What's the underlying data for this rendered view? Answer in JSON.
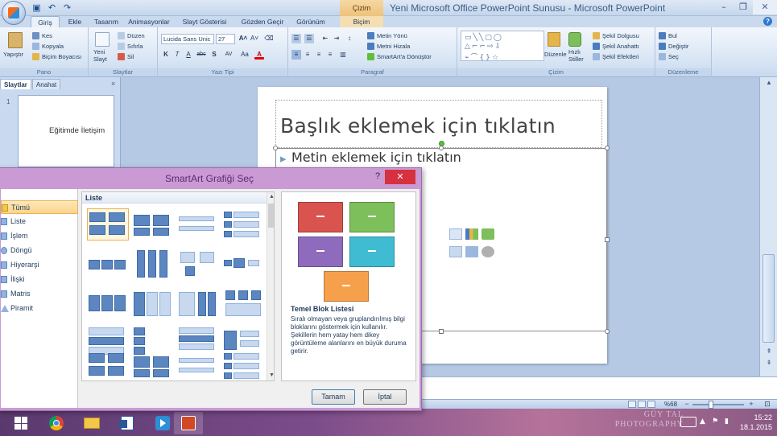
{
  "window": {
    "title": "Yeni Microsoft Office PowerPoint Sunusu - Microsoft PowerPoint",
    "contextual_tab_group": "Çizim Araçları",
    "minimize": "–",
    "restore": "❐",
    "close": "✕"
  },
  "quick_access": [
    "save-icon",
    "undo-icon",
    "redo-icon"
  ],
  "tabs": [
    "Giriş",
    "Ekle",
    "Tasarım",
    "Animasyonlar",
    "Slayt Gösterisi",
    "Gözden Geçir",
    "Görünüm",
    "Biçim"
  ],
  "ribbon": {
    "pano": {
      "label": "Pano",
      "paste": "Yapıştır",
      "cut": "Kes",
      "copy": "Kopyala",
      "format_painter": "Biçim Boyacısı"
    },
    "slaytlar": {
      "label": "Slaytlar",
      "new_slide": "Yeni Slayt",
      "layout": "Düzen",
      "reset": "Sıfırla",
      "delete": "Sil"
    },
    "yazi_tipi": {
      "label": "Yazı Tipi",
      "font": "Lucida Sans Unic",
      "size": "27",
      "grow": "A˄",
      "shrink": "A˅",
      "bold": "K",
      "italic": "T",
      "underline": "A",
      "strike": "abc",
      "shadow": "S",
      "spacing": "AV",
      "case": "Aa",
      "color": "A"
    },
    "paragraf": {
      "label": "Paragraf",
      "text_direction": "Metin Yönü",
      "align_text": "Metni Hizala",
      "smartart": "SmartArt'a Dönüştür"
    },
    "cizim": {
      "label": "Çizim",
      "arrange": "Düzenle",
      "quick_styles": "Hızlı Stiller",
      "fill": "Şekil Dolgusu",
      "outline": "Şekil Anahattı",
      "effects": "Şekil Efektleri"
    },
    "duzenleme": {
      "label": "Düzenleme",
      "find": "Bul",
      "replace": "Değiştir",
      "select": "Seç"
    }
  },
  "left_pane": {
    "tabs": [
      "Slaytlar",
      "Anahat"
    ],
    "close": "×",
    "slide_number": "1",
    "thumb_text": "Eğitimde İletişim"
  },
  "slide": {
    "title": "Başlık eklemek için tıklatın",
    "content": "Metin eklemek için tıklatın",
    "bullet": "▸"
  },
  "dialog": {
    "title": "SmartArt Grafiği Seç",
    "help": "?",
    "close": "✕",
    "categories": [
      "Tümü",
      "Liste",
      "İşlem",
      "Döngü",
      "Hiyerarşi",
      "İlişki",
      "Matris",
      "Piramit"
    ],
    "selected_category": "Tümü",
    "layout_header": "Liste",
    "preview_title": "Temel Blok Listesi",
    "preview_description": "Sıralı olmayan veya gruplandırılmış bilgi bloklarını göstermek için kullanılır. Şekillerin hem yatay hem dikey görüntüleme alanlarını en büyük duruma getirir.",
    "preview_colors": [
      "#d9534f",
      "#7dbf5a",
      "#8e6bbd",
      "#3fbcd1",
      "#f7a04b"
    ],
    "ok": "Tamam",
    "cancel": "İptal"
  },
  "status_bar": {
    "zoom": "%68",
    "minus": "−",
    "plus": "+",
    "fit": "⊡"
  },
  "taskbar": {
    "time": "15:22",
    "date": "18.1.2015",
    "apps": [
      "windows-start",
      "chrome",
      "file-explorer",
      "word",
      "media-player",
      "powerpoint"
    ],
    "watermark_line1": "GÜY TAL",
    "watermark_line2": "PHOTOGRAPHY"
  }
}
